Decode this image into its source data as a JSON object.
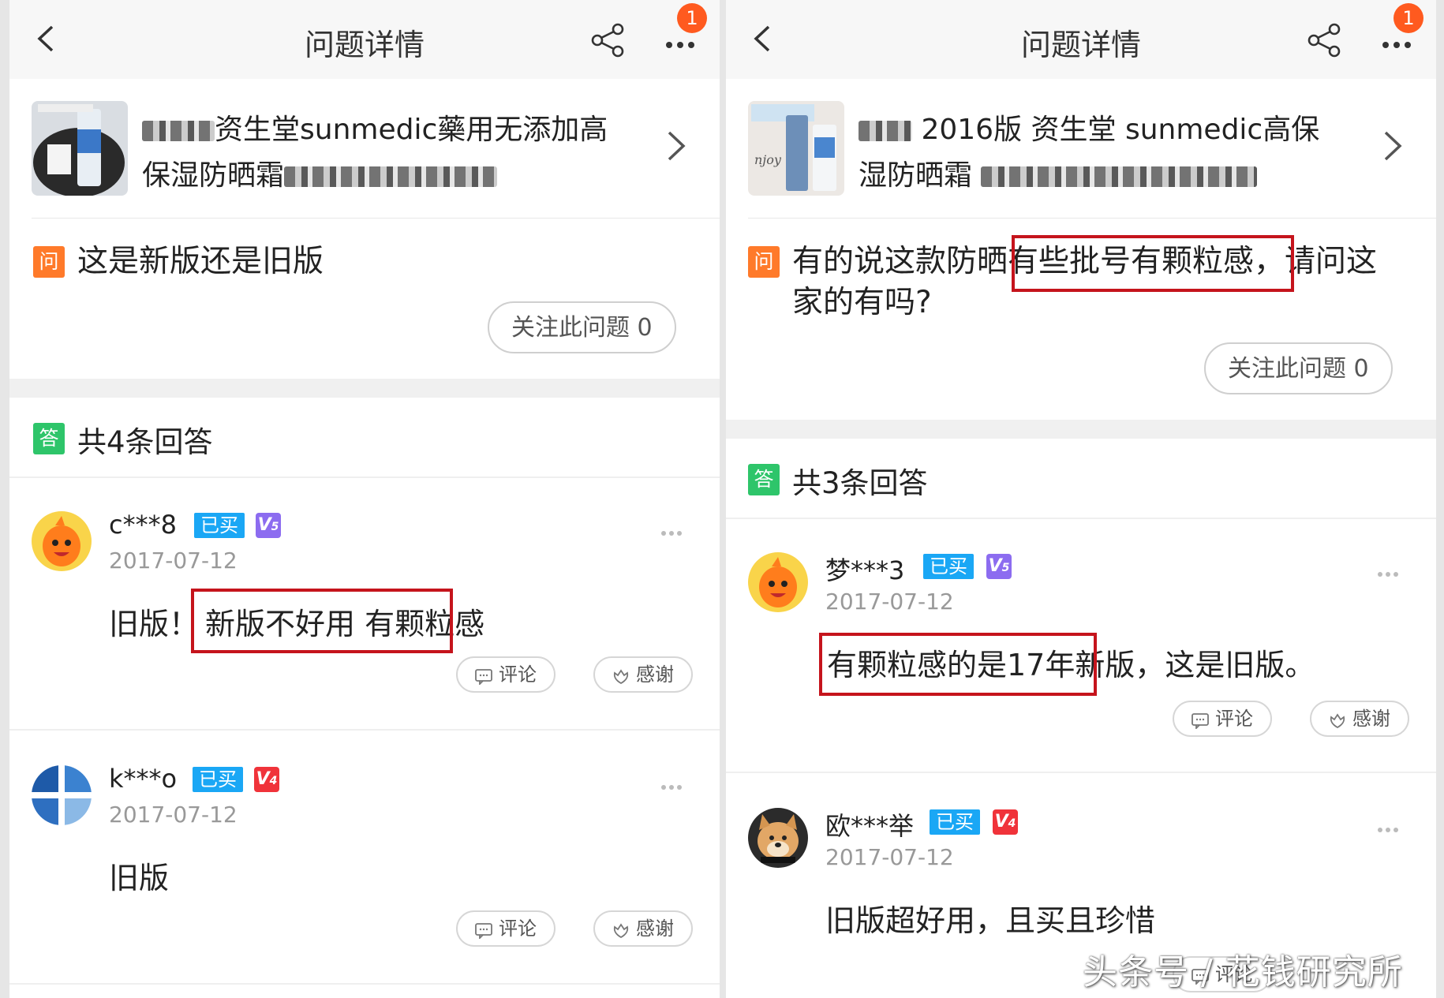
{
  "left": {
    "header": {
      "title": "问题详情",
      "badge": "1"
    },
    "product": {
      "name_line1": "资生堂sunmedic藥用无添加高",
      "name_line2": "保湿防晒霜"
    },
    "question": {
      "icon": "问",
      "text": "这是新版还是旧版",
      "follow_label": "关注此问题 0"
    },
    "answers_header": {
      "icon": "答",
      "title": "共4条回答"
    },
    "answers": [
      {
        "user": "c***8",
        "bought": "已买",
        "level": "5",
        "date": "2017-07-12",
        "text_plain": "旧版！",
        "text_highlight": "新版不好用 有颗粒感",
        "comment": "评论",
        "thanks": "感谢"
      },
      {
        "user": "k***o",
        "bought": "已买",
        "level": "4",
        "date": "2017-07-12",
        "text_plain": "旧版",
        "comment": "评论",
        "thanks": "感谢"
      }
    ]
  },
  "right": {
    "header": {
      "title": "问题详情",
      "badge": "1"
    },
    "product": {
      "name_line1": "2016版 资生堂 sunmedic高保",
      "name_line2": "湿防晒霜"
    },
    "question": {
      "icon": "问",
      "text_before": "有的说这款防晒",
      "text_highlight": "有些批号有颗粒感，",
      "text_after": "请问这",
      "text_line2": "家的有吗?",
      "follow_label": "关注此问题 0"
    },
    "answers_header": {
      "icon": "答",
      "title": "共3条回答"
    },
    "answers": [
      {
        "user": "梦***3",
        "bought": "已买",
        "level": "5",
        "date": "2017-07-12",
        "text_highlight": "有颗粒感的是17年新版，",
        "text_plain": "这是旧版。",
        "comment": "评论",
        "thanks": "感谢"
      },
      {
        "user": "欧***举",
        "bought": "已买",
        "level": "4",
        "date": "2017-07-12",
        "text_plain": "旧版超好用，且买且珍惜",
        "comment": "评论"
      }
    ]
  },
  "watermark": "头条号 / 花钱研究所",
  "colors": {
    "question_icon": "#ff7a2a",
    "answer_icon": "#2ec56a",
    "bought_badge": "#1aa7f5",
    "highlight_box": "#c5141c",
    "v5": "#8c6cf0",
    "v4": "#f0333a",
    "notification_badge": "#ff5a1f"
  }
}
